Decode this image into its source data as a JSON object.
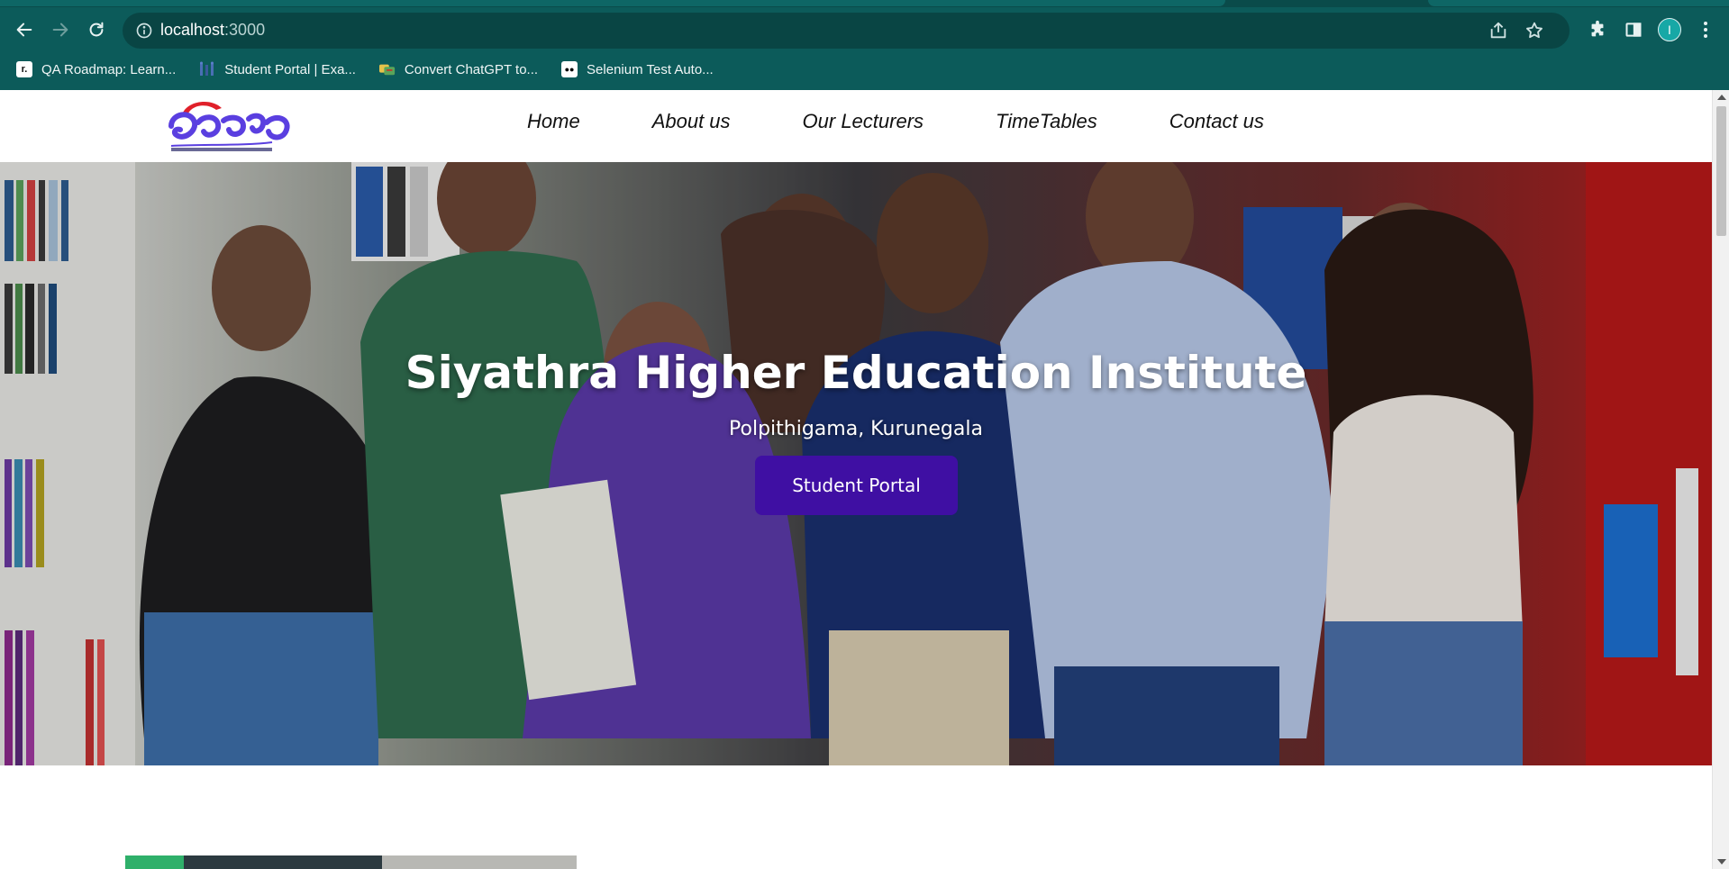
{
  "browser": {
    "url_host": "localhost",
    "url_port": ":3000",
    "profile_initial": "I",
    "bookmarks": [
      {
        "label": "QA Roadmap: Learn...",
        "icon": "r."
      },
      {
        "label": "Student Portal | Exa...",
        "icon": ""
      },
      {
        "label": "Convert ChatGPT to...",
        "icon": ""
      },
      {
        "label": "Selenium Test Auto...",
        "icon": "●●"
      }
    ],
    "colors": {
      "frame": "#0c5b5a",
      "omnibox": "#094544",
      "profile": "#17a8a6"
    }
  },
  "site": {
    "logo_alt": "Siyathra logo",
    "nav": [
      {
        "label": "Home"
      },
      {
        "label": "About us"
      },
      {
        "label": "Our Lecturers"
      },
      {
        "label": "TimeTables"
      },
      {
        "label": "Contact us"
      }
    ],
    "hero": {
      "title": "Siyathra Higher Education Institute",
      "subtitle": "Polpithigama, Kurunegala",
      "cta_label": "Student Portal",
      "cta_color": "#3f0fa3"
    }
  }
}
